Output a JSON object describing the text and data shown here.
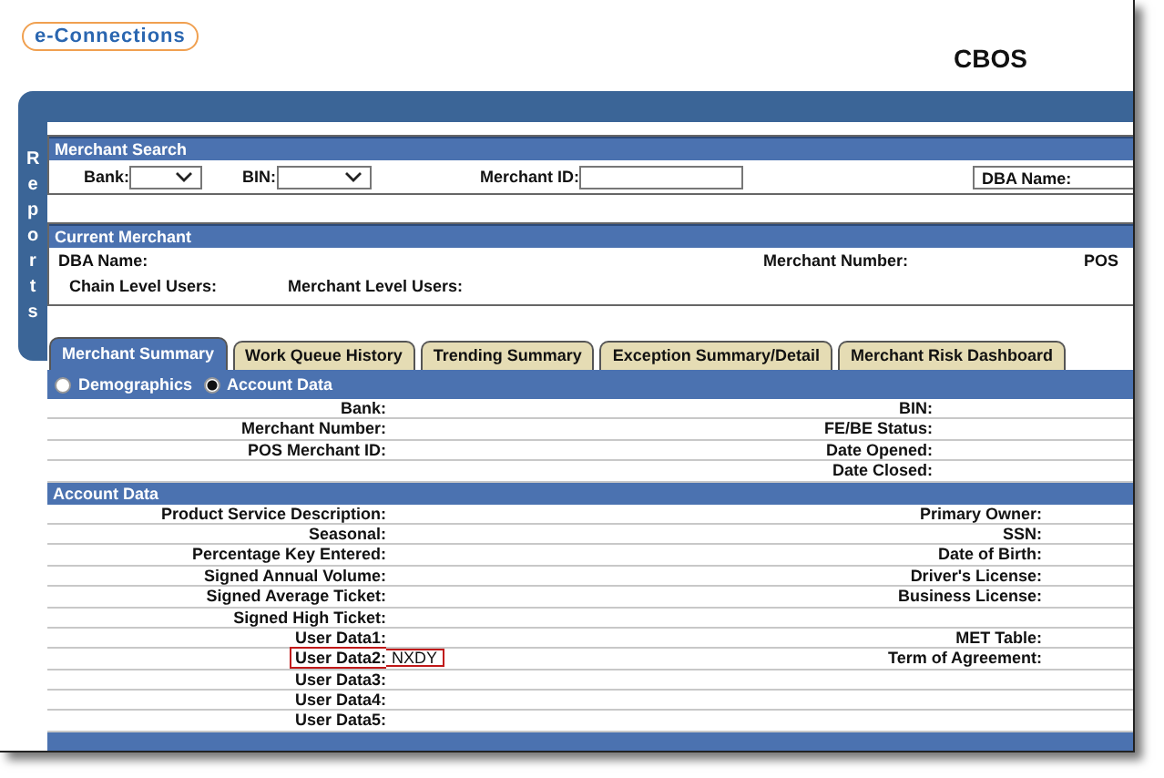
{
  "header": {
    "logo": "e-Connections",
    "title": "CBOS"
  },
  "sidebar": {
    "label": "Reports"
  },
  "merchant_search": {
    "title": "Merchant Search",
    "fields": [
      {
        "label": "Bank:",
        "kind": "select"
      },
      {
        "label": "BIN:",
        "kind": "select"
      },
      {
        "label": "Merchant ID:",
        "kind": "text"
      },
      {
        "label": "DBA Name:",
        "kind": "boxed"
      }
    ]
  },
  "current_merchant": {
    "title": "Current Merchant",
    "rows": [
      [
        "DBA Name:",
        "Merchant Number:",
        "POS"
      ],
      [
        "Chain Level Users:",
        "Merchant Level Users:"
      ]
    ]
  },
  "tabs": [
    {
      "label": "Merchant Summary",
      "selected": true
    },
    {
      "label": "Work Queue History",
      "selected": false
    },
    {
      "label": "Trending Summary",
      "selected": false
    },
    {
      "label": "Exception Summary/Detail",
      "selected": false
    },
    {
      "label": "Merchant Risk Dashboard",
      "selected": false
    }
  ],
  "view_options": [
    {
      "label": "Demographics",
      "selected": false
    },
    {
      "label": "Account Data",
      "selected": true
    }
  ],
  "summary_rows": [
    {
      "left": "Bank:",
      "right": "BIN:"
    },
    {
      "left": "Merchant Number:",
      "right": "FE/BE Status:"
    },
    {
      "left": "POS Merchant ID:",
      "right": "Date Opened:"
    },
    {
      "right": "Date Closed:"
    }
  ],
  "account_data": {
    "title": "Account Data",
    "rows": [
      {
        "left": "Product Service Description:",
        "right": "Primary Owner:",
        "highlighted": false
      },
      {
        "left": "Seasonal:",
        "right": "SSN:",
        "highlighted": false
      },
      {
        "left": "Percentage Key Entered:",
        "right": "Date of Birth:",
        "highlighted": false
      },
      {
        "left": "Signed Annual Volume:",
        "right": "Driver's License:",
        "highlighted": false
      },
      {
        "left": "Signed Average Ticket:",
        "right": "Business License:",
        "highlighted": false
      },
      {
        "left": "Signed High Ticket:",
        "highlighted": false
      },
      {
        "left": "User Data1:",
        "right": "MET Table:",
        "highlighted": false
      },
      {
        "left": "User Data2:",
        "value": "NXDY",
        "right": "Term of Agreement:",
        "highlighted": true
      },
      {
        "left": "User Data3:",
        "highlighted": false
      },
      {
        "left": "User Data4:",
        "highlighted": false
      },
      {
        "left": "User Data5:",
        "highlighted": false
      }
    ]
  }
}
